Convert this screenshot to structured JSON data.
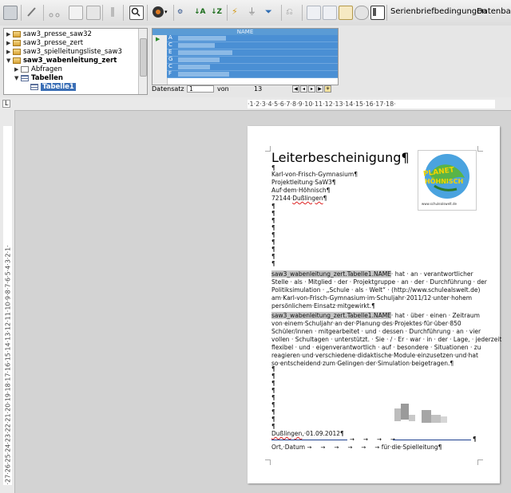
{
  "toolbar": {
    "serienbrief_label": "Serienbriefbedingungen",
    "datenbank_label": "Datenbank"
  },
  "datasource": {
    "tree": [
      {
        "label": "saw3_presse_saw32",
        "bold": false,
        "icon": "folder-icon"
      },
      {
        "label": "saw3_presse_zert",
        "bold": false,
        "icon": "folder-icon"
      },
      {
        "label": "saw3_spielleitungsliste_saw3",
        "bold": false,
        "icon": "folder-icon"
      },
      {
        "label": "saw3_wabenleitung_zert",
        "bold": true,
        "icon": "folder-icon"
      },
      {
        "label": "Abfragen",
        "bold": false,
        "icon": "query-icon"
      },
      {
        "label": "Tabellen",
        "bold": true,
        "icon": "tables-icon"
      },
      {
        "label": "Tabelle1",
        "bold": false,
        "icon": "table-icon",
        "selected": true
      }
    ],
    "grid_header": "NAME",
    "grid_rows": [
      "A",
      "C",
      "E",
      "G",
      "C",
      "F"
    ],
    "nav": {
      "datensatz_label": "Datensatz",
      "record_value": "1",
      "von_label": "von",
      "total": "13"
    }
  },
  "ruler": {
    "horizontal": "·1·2·3·4·5·6·7·8·9·10·11·12·13·14·15·16·17·18·",
    "vertical": "·27·26·25·24·23·22·21·20·19·18·17·16·15·14·13·12·11·10·9·8·7·6·5·4·3·2·1·"
  },
  "document": {
    "title": "Leiterbescheinigung¶",
    "pilcrow": "¶",
    "address": [
      "Karl-von-Frisch-Gymnasium¶",
      "Projektleitung·SaW3¶",
      "Auf·dem·Höhnisch¶"
    ],
    "address_city_prefix": "72144·",
    "address_city": "Dußlingen",
    "logo_text_top": "PLANET",
    "logo_text_bottom": "HÖHNISCH",
    "logo_url": "www.schulealswelt.de",
    "field_name": "saw3_wabenleitung_zert.Tabelle1.NAME",
    "para1_after_field": "· hat · an · verantwortlicher",
    "para1_lines": [
      "Stelle · als · Mitglied · der · Projektgruppe · an · der · Durchführung · der",
      "Politiksimulation · „Schule · als · Welt“ · (http://www.schulealswelt.de)",
      "am·Karl-von-Frisch-Gymnasium·im·Schuljahr·2011/12·unter·hohem",
      "persönlichem·Einsatz·mitgewirkt.¶"
    ],
    "para2_after_field": "· hat · über · einen · Zeitraum",
    "para2_lines": [
      "von·einem·Schuljahr·an·der·Planung·des·Projektes·für·über·850",
      "Schüler/innen · mitgearbeitet · und · dessen · Durchführung · an · vier",
      "vollen · Schultagen · unterstützt. · Sie · / · Er · war · in · der · Lage, · jederzeit",
      "flexibel · und · eigenverantwortlich · auf · besondere · Situationen · zu",
      "reagieren·und·verschiedene·didaktische·Module·einzusetzen·und·hat",
      "so·entscheidend·zum·Gelingen·der·Simulation·beigetragen.¶"
    ],
    "date_place": "Dußlingen",
    "date_value": ",·01.09.2012¶",
    "sig_arrows": "→     →     →     →",
    "sig_end": "¶",
    "footer_left": "Ort,·Datum",
    "footer_arrows": "→     →     →     →     →     →",
    "footer_right": "für·die·Spielleitung¶"
  }
}
